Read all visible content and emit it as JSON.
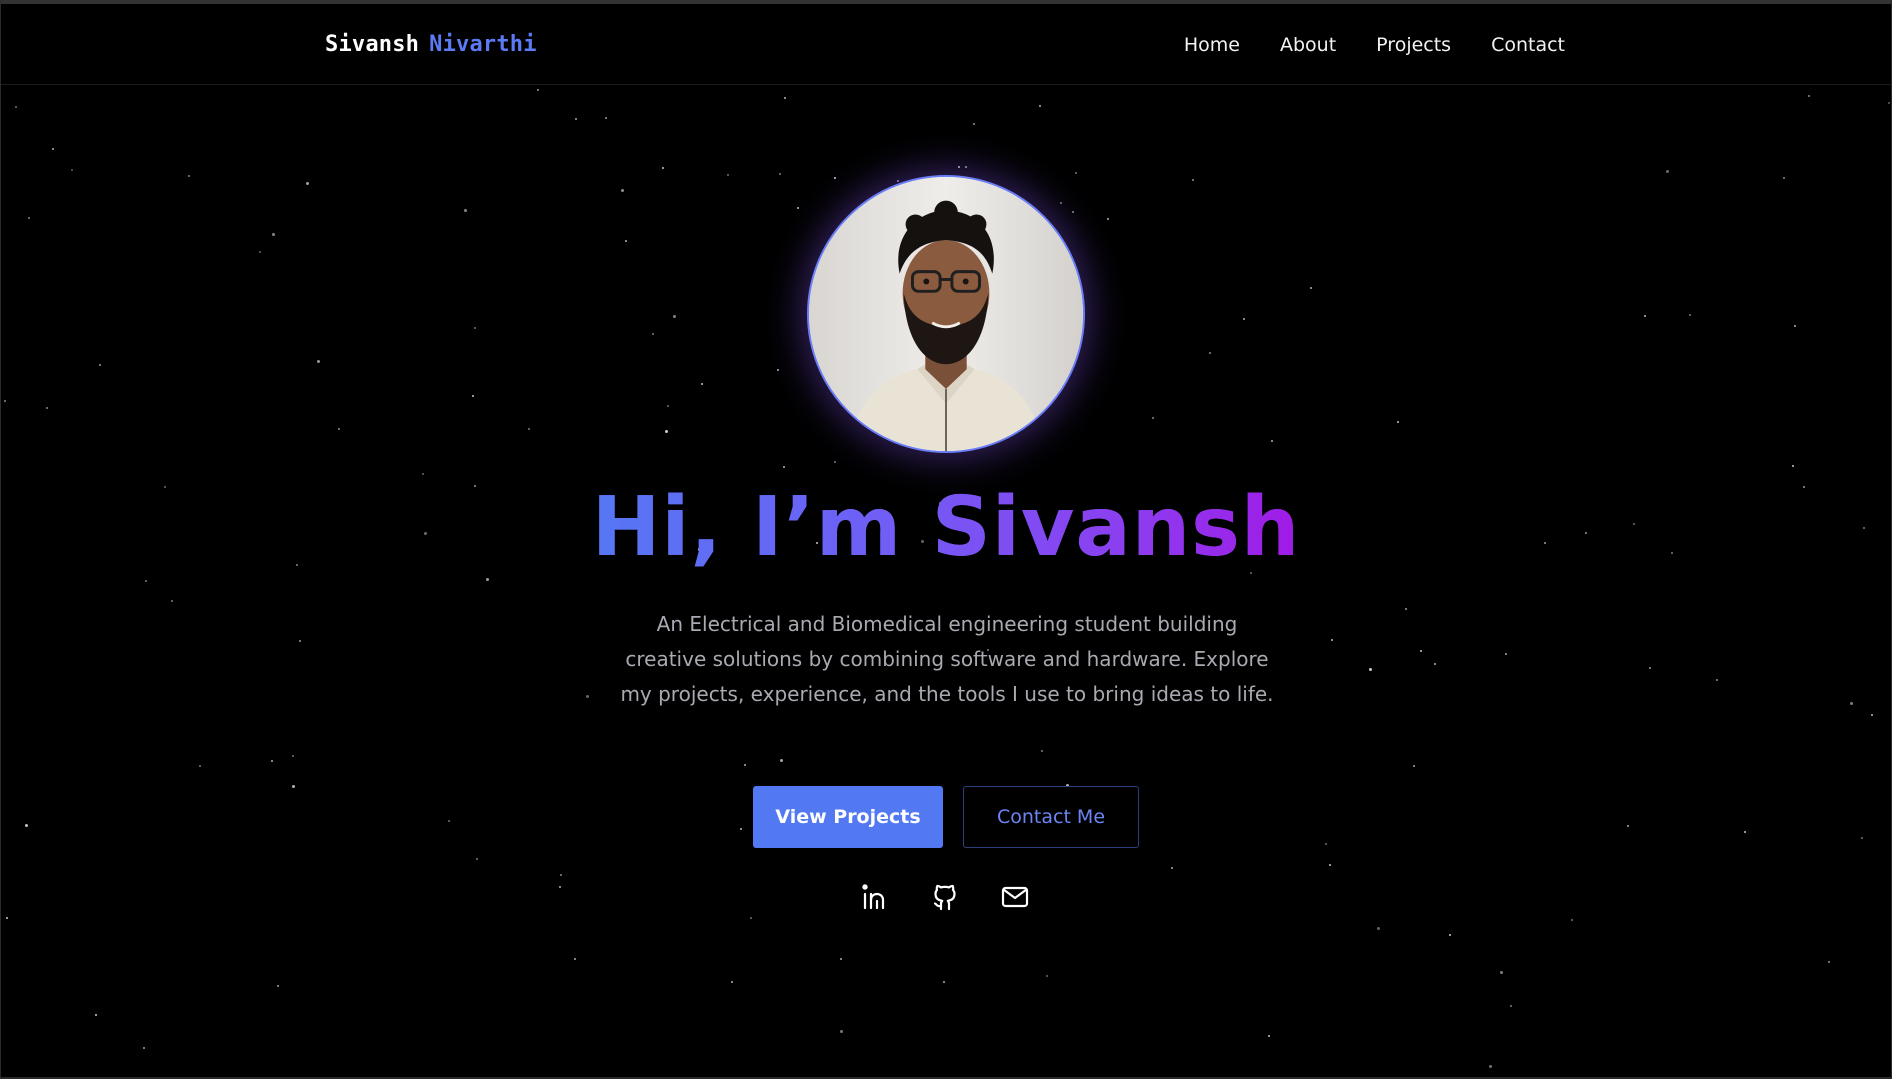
{
  "brand": {
    "first_name": "Sivansh",
    "last_name": "Nivarthi"
  },
  "nav": {
    "items": [
      {
        "label": "Home"
      },
      {
        "label": "About"
      },
      {
        "label": "Projects"
      },
      {
        "label": "Contact"
      }
    ]
  },
  "hero": {
    "headline": "Hi, I’m Sivansh",
    "intro": "An Electrical and Biomedical engineering student building creative solutions by combining software and hardware. Explore my projects, experience, and the tools I use to bring ideas to life.",
    "buttons": {
      "primary_label": "View Projects",
      "secondary_label": "Contact Me"
    },
    "socials": [
      {
        "icon": "linkedin-icon"
      },
      {
        "icon": "github-icon"
      },
      {
        "icon": "mail-icon"
      }
    ]
  },
  "colors": {
    "background": "#000000",
    "accent": "#5279f2",
    "gradient_start": "#5577f4",
    "gradient_end": "#a01ae6",
    "body_text": "#a9a9b2"
  }
}
